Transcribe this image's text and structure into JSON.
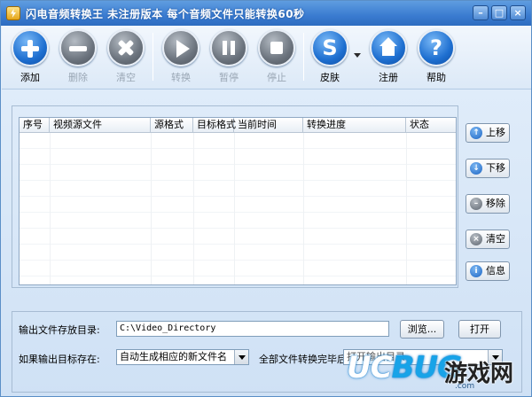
{
  "window": {
    "title": "闪电音频转换王  未注册版本 每个音频文件只能转换60秒",
    "min_label": "–",
    "max_label": "□",
    "close_label": "×"
  },
  "toolbar": {
    "add": "添加",
    "delete": "删除",
    "clear": "清空",
    "convert": "转换",
    "pause": "暂停",
    "stop": "停止",
    "skin": "皮肤",
    "skin_glyph": "S",
    "register": "注册",
    "help": "帮助",
    "help_glyph": "?"
  },
  "table": {
    "columns": [
      "序号",
      "视频源文件",
      "源格式",
      "目标格式",
      "当前时间",
      "转换进度",
      "状态"
    ]
  },
  "side_buttons": {
    "up": "上移",
    "down": "下移",
    "remove": "移除",
    "clear": "清空",
    "info": "信息"
  },
  "output": {
    "dir_label": "输出文件存放目录:",
    "dir_value": "C:\\Video_Directory",
    "browse": "浏览...",
    "open": "打开",
    "exists_label": "如果输出目标存在:",
    "exists_value": "自动生成相应的新文件名",
    "after_label": "全部文件转换完毕后:",
    "after_value": "打开输出目录"
  },
  "watermark": {
    "brand_uc": "UC",
    "brand_bug": "BUG",
    "brand_cn": "游戏网",
    "url": ".com"
  },
  "colors": {
    "titlebar": "#3a7bd0",
    "accent_blue": "#1e6fd0",
    "disabled_gray": "#6c747e"
  }
}
